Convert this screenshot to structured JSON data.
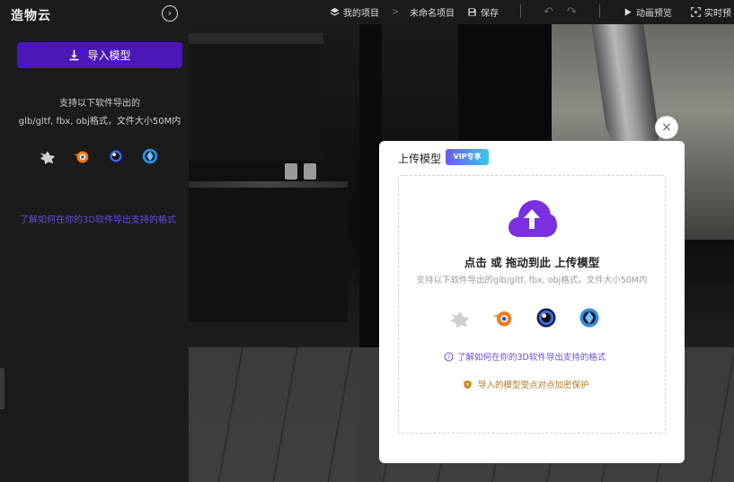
{
  "sidebar": {
    "brand": "造物云",
    "import_button": "导入模型",
    "desc_line1": "支持以下软件导出的",
    "desc_line2": "glb/gltf, fbx, obj格式，文件大小50M内",
    "help_link": "了解如何在你的3D软件导出支持的格式",
    "software_icons": [
      "3dsmax-icon",
      "blender-icon",
      "cinema4d-icon",
      "keyshot-icon"
    ]
  },
  "topbar": {
    "my_projects": "我的项目",
    "separator": ">",
    "project_name": "未命名项目",
    "save": "保存",
    "animation_preview": "动画预览",
    "realtime_preview": "实时预"
  },
  "modal": {
    "title": "上传模型",
    "vip_badge": "VIP专享",
    "close": "×",
    "dropzone_main": "点击 或 拖动到此 上传模型",
    "dropzone_sub": "支持以下软件导出的glb/gltf, fbx, obj格式，文件大小50M内",
    "help_link": "了解如何在你的3D软件导出支持的格式",
    "protection_note": "导入的模型受点对点加密保护"
  },
  "colors": {
    "accent": "#4b17b8",
    "link": "#6b4dd6",
    "upload_cloud": "#7a2fe0",
    "protection": "#b07a1f"
  }
}
